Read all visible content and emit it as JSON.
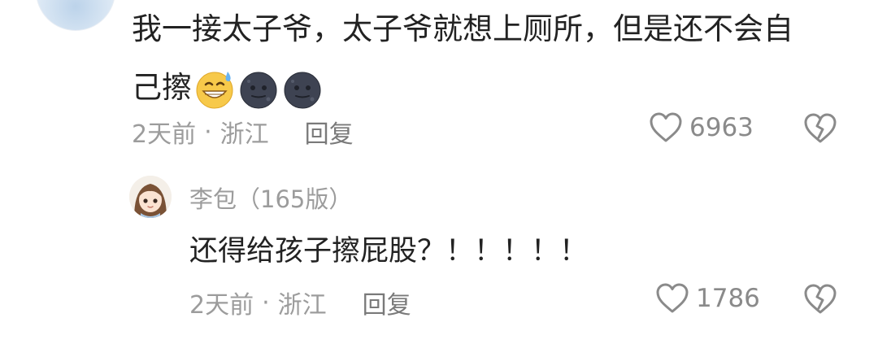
{
  "parent_comment": {
    "text_line1": "我一接太子爷，太子爷就想上厕所，但是还不会自",
    "text_line2": "己擦",
    "emojis": [
      "grinning-sweat-emoji",
      "dark-moon-face-emoji",
      "dark-moon-face-emoji"
    ],
    "time": "2天前",
    "separator": "·",
    "location": "浙江",
    "reply_label": "回复",
    "like_count": "6963"
  },
  "reply_comment": {
    "author": "李包（165版）",
    "text": "还得给孩子擦屁股？！！！！！",
    "time": "2天前",
    "separator": "·",
    "location": "浙江",
    "reply_label": "回复",
    "like_count": "1786"
  },
  "icons": {
    "like": "heart-outline-icon",
    "dislike": "broken-heart-icon"
  },
  "colors": {
    "text_primary": "#222222",
    "text_meta": "#9c9c9c",
    "icon_gray": "#8a8a8a"
  }
}
